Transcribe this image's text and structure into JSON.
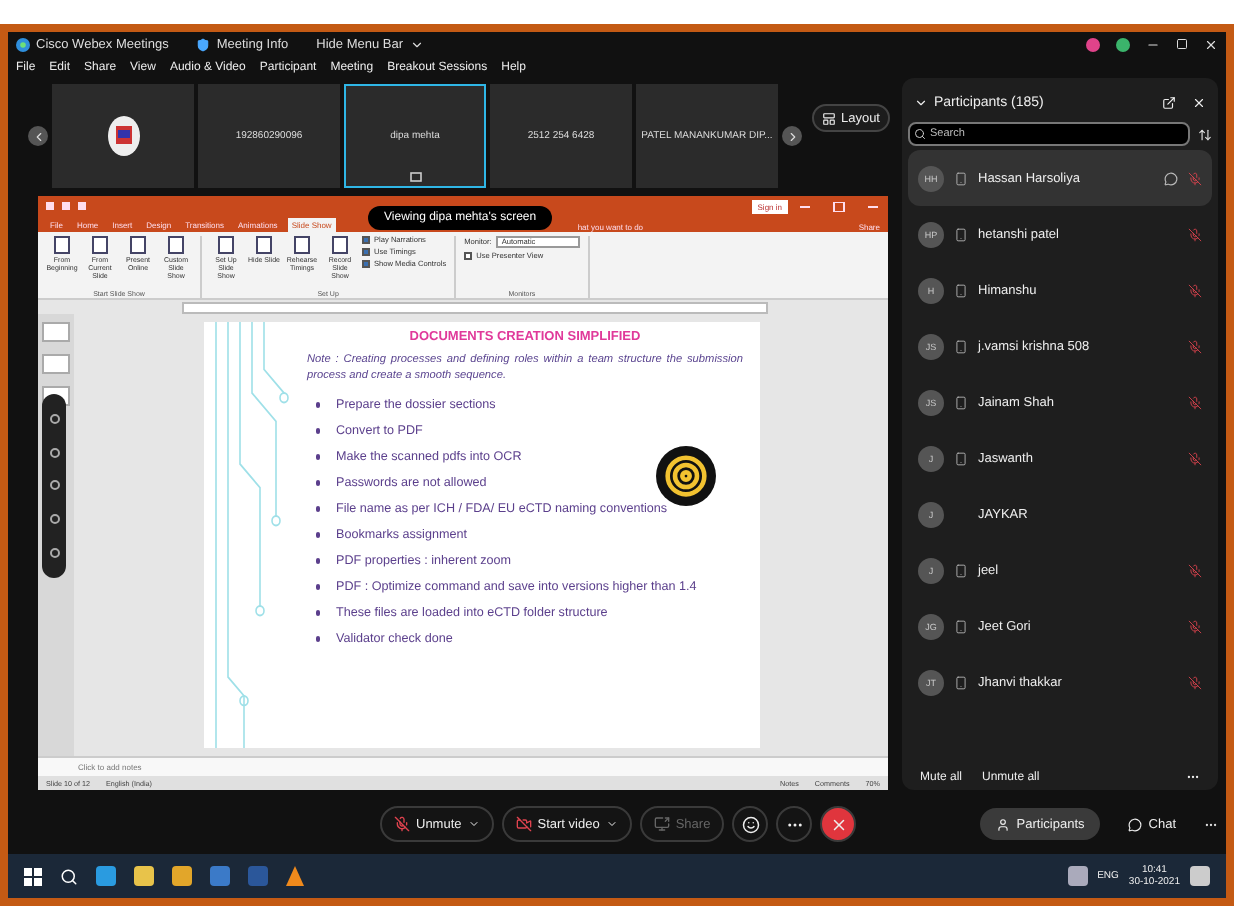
{
  "window": {
    "app_title": "Cisco Webex Meetings",
    "meeting_info": "Meeting Info",
    "hide_menu": "Hide Menu Bar"
  },
  "menu": [
    "File",
    "Edit",
    "Share",
    "View",
    "Audio & Video",
    "Participant",
    "Meeting",
    "Breakout Sessions",
    "Help"
  ],
  "video_strip": [
    {
      "kind": "logo",
      "selected": false
    },
    {
      "kind": "name",
      "label": "192860290096",
      "selected": false
    },
    {
      "kind": "name",
      "label": "dipa mehta",
      "selected": true
    },
    {
      "kind": "name",
      "label": "2512 254 6428",
      "selected": false
    },
    {
      "kind": "name",
      "label": "PATEL MANANKUMAR DIP...",
      "selected": false
    }
  ],
  "layout_button": "Layout",
  "viewing_banner": "Viewing dipa mehta's screen",
  "shared_screen": {
    "sign_in": "Sign in",
    "tabs": [
      {
        "label": "File",
        "selected": false
      },
      {
        "label": "Home",
        "selected": false
      },
      {
        "label": "Insert",
        "selected": false
      },
      {
        "label": "Design",
        "selected": false
      },
      {
        "label": "Transitions",
        "selected": false
      },
      {
        "label": "Animations",
        "selected": false
      },
      {
        "label": "Slide Show",
        "selected": true
      }
    ],
    "tell_me": "hat you want to do",
    "share": "Share",
    "ribbon_groups": [
      {
        "label": "Start Slide Show",
        "buttons": [
          "From Beginning",
          "From Current Slide",
          "Present Online",
          "Custom Slide Show"
        ]
      },
      {
        "label": "Set Up",
        "buttons": [
          "Set Up Slide Show",
          "Hide Slide",
          "Rehearse Timings",
          "Record Slide Show"
        ],
        "checks": [
          {
            "label": "Play Narrations",
            "checked": true
          },
          {
            "label": "Use Timings",
            "checked": true
          },
          {
            "label": "Show Media Controls",
            "checked": true
          }
        ]
      },
      {
        "label": "Monitors",
        "monitor_label": "Monitor:",
        "monitor_value": "Automatic",
        "checks": [
          {
            "label": "Use Presenter View",
            "checked": false
          }
        ]
      }
    ],
    "slide": {
      "title": "DOCUMENTS CREATION SIMPLIFIED",
      "note": "Note : Creating processes and defining roles within a team structure the submission process and create a smooth sequence.",
      "bullets": [
        "Prepare the dossier sections",
        "Convert to PDF",
        "Make the scanned pdfs into OCR",
        "Passwords are not allowed",
        "File name as per ICH / FDA/ EU eCTD naming conventions",
        "Bookmarks assignment",
        "PDF properties : inherent zoom",
        "PDF : Optimize command and save into versions higher than 1.4",
        "These files are loaded into eCTD folder structure",
        "Validator check done"
      ]
    },
    "notes_placeholder": "Click to add notes",
    "status": {
      "slide": "Slide 10 of 12",
      "language": "English (India)",
      "notes": "Notes",
      "comments": "Comments",
      "zoom": "70%"
    }
  },
  "participants": {
    "title": "Participants (185)",
    "search_placeholder": "Search",
    "items": [
      {
        "initials": "HH",
        "name": "Hassan Harsoliya",
        "device": true,
        "muted": true,
        "selected": true
      },
      {
        "initials": "HP",
        "name": "hetanshi patel",
        "device": true,
        "muted": true,
        "selected": false
      },
      {
        "initials": "H",
        "name": "Himanshu",
        "device": true,
        "muted": true,
        "selected": false
      },
      {
        "initials": "JS",
        "name": "j.vamsi krishna 508",
        "device": true,
        "muted": true,
        "selected": false
      },
      {
        "initials": "JS",
        "name": "Jainam Shah",
        "device": true,
        "muted": true,
        "selected": false
      },
      {
        "initials": "J",
        "name": "Jaswanth",
        "device": true,
        "muted": true,
        "selected": false
      },
      {
        "initials": "J",
        "name": "JAYKAR",
        "device": false,
        "muted": false,
        "selected": false
      },
      {
        "initials": "J",
        "name": "jeel",
        "device": true,
        "muted": true,
        "selected": false
      },
      {
        "initials": "JG",
        "name": "Jeet Gori",
        "device": true,
        "muted": true,
        "selected": false
      },
      {
        "initials": "JT",
        "name": "Jhanvi thakkar",
        "device": true,
        "muted": true,
        "selected": false
      }
    ],
    "mute_all": "Mute all",
    "unmute_all": "Unmute all"
  },
  "controls": [
    {
      "kind": "unmute",
      "label": "Unmute",
      "disabled": false
    },
    {
      "kind": "video",
      "label": "Start video",
      "disabled": false
    },
    {
      "kind": "share",
      "label": "Share",
      "disabled": true
    }
  ],
  "panel_tabs": [
    {
      "label": "Participants",
      "selected": true
    },
    {
      "label": "Chat",
      "selected": false
    }
  ],
  "taskbar": {
    "language": "ENG",
    "time": "10:41",
    "date": "30-10-2021"
  }
}
